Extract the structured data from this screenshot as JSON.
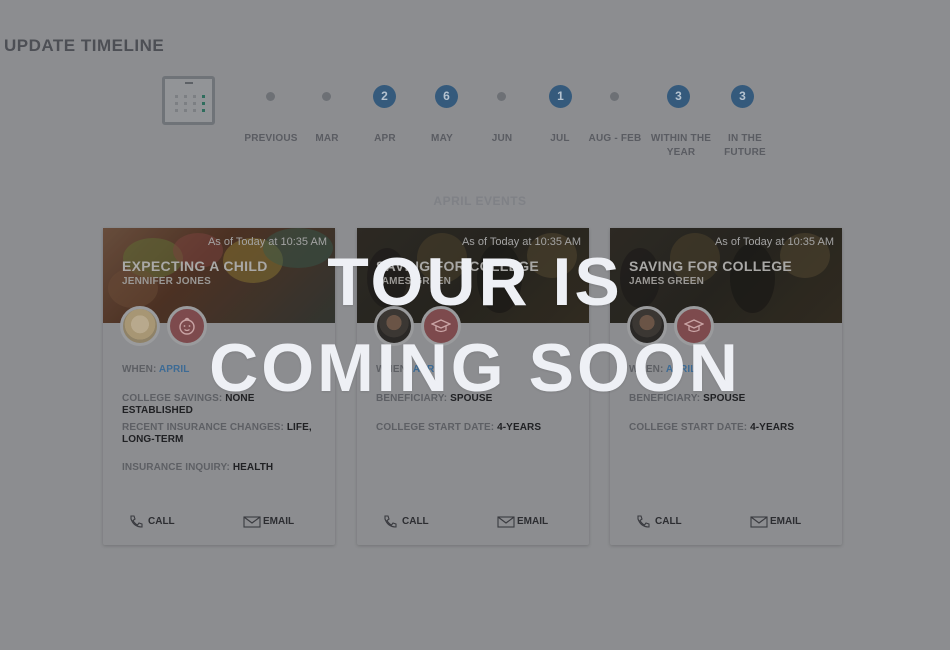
{
  "section": {
    "title": "UPDATE TIMELINE"
  },
  "timeline": {
    "steps": [
      {
        "label": "PREVIOUS",
        "count": null
      },
      {
        "label": "MAR",
        "count": null
      },
      {
        "label": "APR",
        "count": "2"
      },
      {
        "label": "MAY",
        "count": "6"
      },
      {
        "label": "JUN",
        "count": null
      },
      {
        "label": "JUL",
        "count": "1"
      },
      {
        "label": "AUG - FEB",
        "count": null
      },
      {
        "label": "WITHIN THE YEAR",
        "count": "3"
      },
      {
        "label": "IN THE FUTURE",
        "count": "3"
      }
    ]
  },
  "events": {
    "heading": "APRIL EVENTS"
  },
  "cards": [
    {
      "as_of": "As of Today at 10:35 AM",
      "title": "EXPECTING A CHILD",
      "subtitle": "JENNIFER JONES",
      "rows": [
        {
          "key": "WHEN:",
          "value": "APRIL"
        },
        {
          "key": "COLLEGE SAVINGS:",
          "value": "NONE ESTABLISHED"
        },
        {
          "key": "RECENT INSURANCE CHANGES:",
          "value": "LIFE, LONG-TERM"
        },
        {
          "key": "INSURANCE INQUIRY:",
          "value": "HEALTH"
        }
      ],
      "call": "CALL",
      "email": "EMAIL"
    },
    {
      "as_of": "As of Today at 10:35 AM",
      "title": "SAVING FOR COLLEGE",
      "subtitle": "JAMES GREEN",
      "rows": [
        {
          "key": "WHEN:",
          "value": "APRIL"
        },
        {
          "key": "BENEFICIARY:",
          "value": "SPOUSE"
        },
        {
          "key": "COLLEGE START DATE:",
          "value": "4-YEARS"
        }
      ],
      "call": "CALL",
      "email": "EMAIL"
    },
    {
      "as_of": "As of Today at 10:35 AM",
      "title": "SAVING FOR COLLEGE",
      "subtitle": "JAMES GREEN",
      "rows": [
        {
          "key": "WHEN:",
          "value": "APRIL"
        },
        {
          "key": "BENEFICIARY:",
          "value": "SPOUSE"
        },
        {
          "key": "COLLEGE START DATE:",
          "value": "4-YEARS"
        }
      ],
      "call": "CALL",
      "email": "EMAIL"
    }
  ],
  "overlay": {
    "line1": "TOUR IS",
    "line2": "COMING SOON"
  },
  "icons": {
    "calendar": "calendar-icon",
    "phone": "phone-icon",
    "email": "envelope-icon",
    "baby": "baby-face-icon",
    "grad": "graduation-cap-icon"
  },
  "colors": {
    "background_dim": "#8c8d90",
    "badge": "#355a7c",
    "icon_red": "#7d4a4d",
    "overlay_text": "#eef0f5"
  }
}
